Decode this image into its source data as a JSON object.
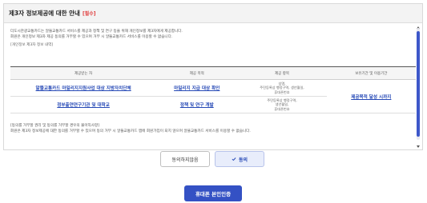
{
  "panel": {
    "title": "제3자 정보제공에 대한 안내",
    "required": "[필수]"
  },
  "intro": {
    "line1": "더도시관광교통카드는 알뜰교통카드 서비스를 제공과 정책 및 연구 등을 위해 개인정보를 제3자에게 제공합니다.",
    "line2": "회원은 개인정보 제3자 제공 동의를 거부할 수 있으며 거부 시 알뜰교통카드 서비스를 이용할 수 없습니다.",
    "line3": "[개인정보 제3자 정보 내역]"
  },
  "table": {
    "headers": [
      "제공받는 자",
      "제공 목적",
      "제공 항목",
      "보유기간 및 이용기간"
    ],
    "rows": [
      {
        "recipient": "알뜰교통카드 마일리지지원사업 대상 지방자치단체",
        "purpose": "마일리지 지급 대상 확인",
        "items": [
          "성명,",
          "주민등록상 행정구역, 생년월일,",
          "휴대폰번호"
        ]
      },
      {
        "recipient": "정부출연연구기관 및 대학교",
        "purpose": "정책 및 연구 개발",
        "items": [
          "주민등록상 행정구역,",
          "생년월일,",
          "휴대폰번호"
        ]
      }
    ],
    "retention": "제공목적 달성 시까지"
  },
  "notice": {
    "line1": "[동의를 거부할 권리 및 동의를 거부할 경우의 불이익사항]",
    "line2": "회원은 제3자 정보제공에 대한 동의를 거부할 수 있으며 동의 거부 시 알뜰교통카드 앱에 회원가입이 되지 않으며 알뜰교통카드 서비스를 이용할 수 없습니다."
  },
  "buttons": {
    "disagree": "동의하지않음",
    "agree": "동의",
    "verify": "휴대폰 본인인증"
  },
  "colors": {
    "accent": "#3451c4",
    "link": "#2649b6",
    "required": "#e03a3a"
  }
}
